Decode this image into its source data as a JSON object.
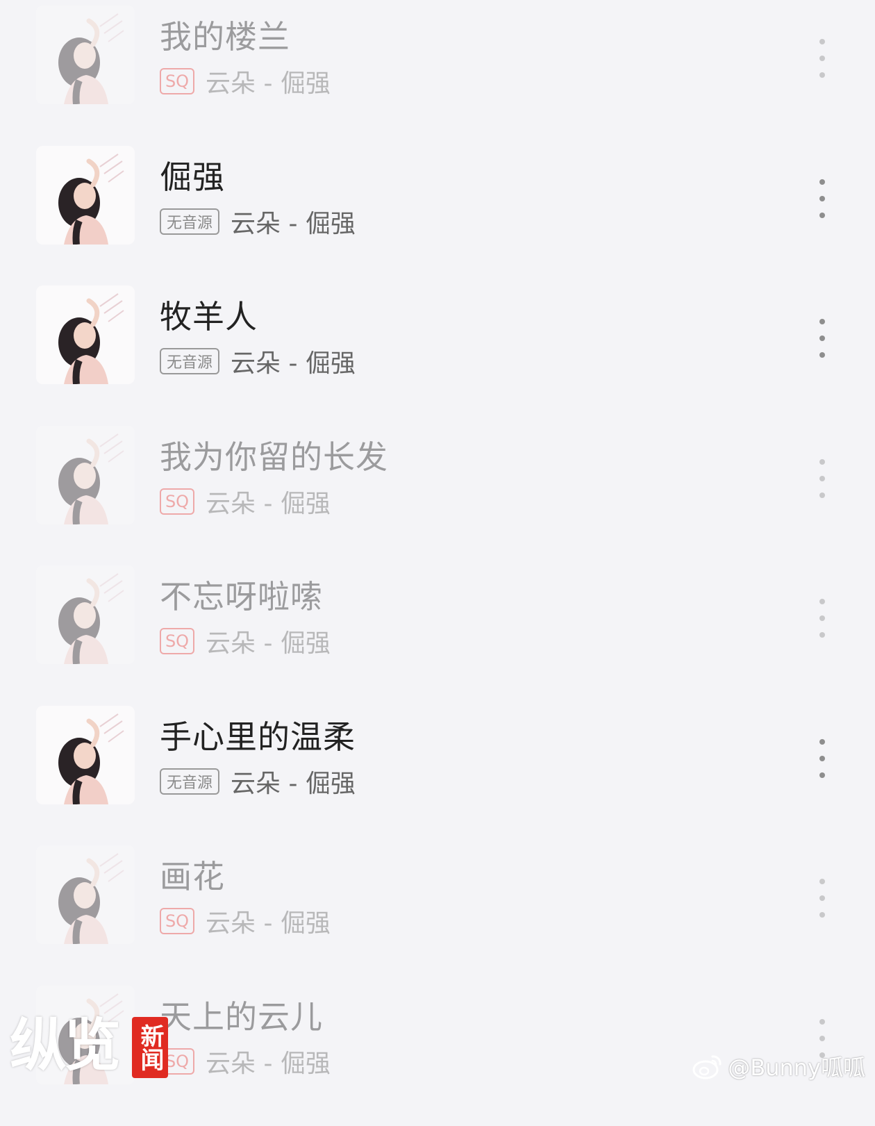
{
  "songs": [
    {
      "title": "我的楼兰",
      "badge": "SQ",
      "badge_type": "sq",
      "artist_album": "云朵 - 倔强",
      "available": false
    },
    {
      "title": "倔强",
      "badge": "无音源",
      "badge_type": "nosrc",
      "artist_album": "云朵 - 倔强",
      "available": true
    },
    {
      "title": "牧羊人",
      "badge": "无音源",
      "badge_type": "nosrc",
      "artist_album": "云朵 - 倔强",
      "available": true
    },
    {
      "title": "我为你留的长发",
      "badge": "SQ",
      "badge_type": "sq",
      "artist_album": "云朵 - 倔强",
      "available": false
    },
    {
      "title": "不忘呀啦嗦",
      "badge": "SQ",
      "badge_type": "sq",
      "artist_album": "云朵 - 倔强",
      "available": false
    },
    {
      "title": "手心里的温柔",
      "badge": "无音源",
      "badge_type": "nosrc",
      "artist_album": "云朵 - 倔强",
      "available": true
    },
    {
      "title": "画花",
      "badge": "SQ",
      "badge_type": "sq",
      "artist_album": "云朵 - 倔强",
      "available": false
    },
    {
      "title": "天上的云儿",
      "badge": "SQ",
      "badge_type": "sq",
      "artist_album": "云朵 - 倔强",
      "available": false
    }
  ],
  "overlay": {
    "logo_main": "纵览",
    "logo_tag": "新闻",
    "watermark": "@Bunny呱呱"
  },
  "colors": {
    "sq_badge": "#e8443f",
    "logo_tag_bg": "#e02b22",
    "background": "#f4f4f7"
  }
}
